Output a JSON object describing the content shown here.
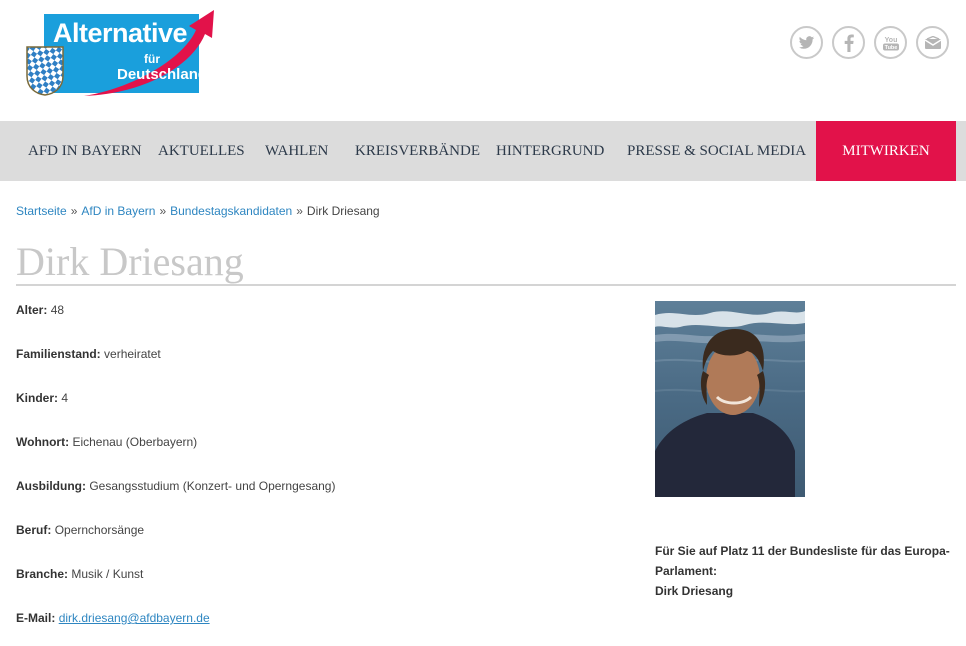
{
  "brand": {
    "word": "Alternative",
    "fuer": "für",
    "de": "Deutschland",
    "colors": {
      "blue": "#1a9fdc",
      "red": "#e2124a",
      "nav_bg": "#dcdcdc"
    }
  },
  "social": [
    {
      "name": "twitter",
      "icon": "twitter-bird-icon"
    },
    {
      "name": "facebook",
      "icon": "facebook-f-icon"
    },
    {
      "name": "youtube",
      "icon": "youtube-icon",
      "label": "You Tube"
    },
    {
      "name": "newsletter",
      "icon": "envelope-icon"
    }
  ],
  "nav": {
    "items": [
      "AFD IN BAYERN",
      "AKTUELLES",
      "WAHLEN",
      "KREISVERBÄNDE",
      "HINTERGRUND",
      "PRESSE & SOCIAL MEDIA"
    ],
    "cta": "MITWIRKEN"
  },
  "breadcrumb": {
    "items": [
      "Startseite",
      "AfD in Bayern",
      "Bundestagskandidaten"
    ],
    "sep": "»",
    "current": "Dirk Driesang"
  },
  "page_title": "Dirk Driesang",
  "profile": {
    "rows": [
      {
        "label": "Alter:",
        "value": "48"
      },
      {
        "label": "Familienstand:",
        "value": "verheiratet"
      },
      {
        "label": "Kinder:",
        "value": "4"
      },
      {
        "label": "Wohnort:",
        "value": "Eichenau (Oberbayern)"
      },
      {
        "label": "Ausbildung:",
        "value": "Gesangsstudium (Konzert- und Operngesang)"
      },
      {
        "label": "Beruf:",
        "value": "Opernchorsänge"
      },
      {
        "label": "Branche:",
        "value": "Musik / Kunst"
      },
      {
        "label": "E-Mail:",
        "value": "dirk.driesang@afdbayern.de"
      }
    ]
  },
  "caption": {
    "line1": "Für Sie auf Platz 11 der Bundesliste für das Europa-Parlament:",
    "line2": "Dirk Driesang"
  }
}
